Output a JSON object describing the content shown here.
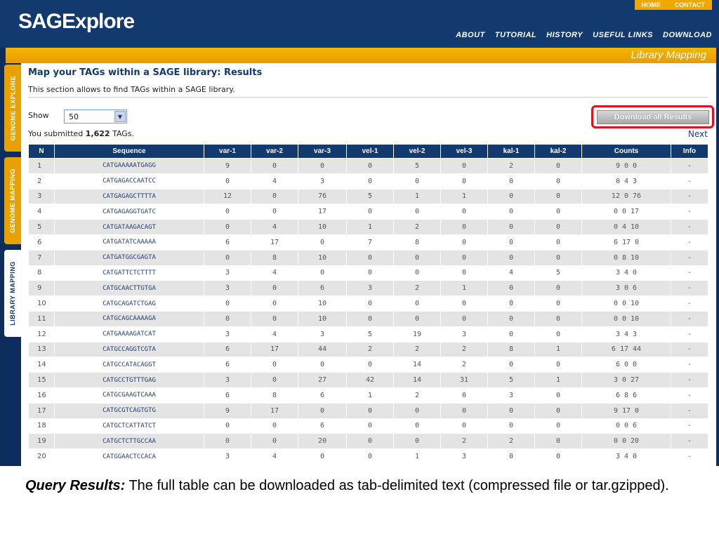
{
  "app": {
    "logo": "SAGExplore",
    "top_links": [
      "HOME",
      "CONTACT"
    ],
    "nav_links": [
      "ABOUT",
      "TUTORIAL",
      "HISTORY",
      "USEFUL LINKS",
      "DOWNLOAD"
    ],
    "section_title": "Library Mapping",
    "side_tabs": [
      "GENOME EXPLORE",
      "GENOME MAPPING",
      "LIBRARY MAPPING"
    ]
  },
  "page": {
    "title": "Map your TAGs within a SAGE library: Results",
    "description": "This section allows to find TAGs within a SAGE library.",
    "show_label": "Show",
    "show_value": "50",
    "submitted_prefix": "You submitted ",
    "submitted_count": "1,622",
    "submitted_suffix": " TAGs.",
    "download_label": "Download all Results",
    "next_label": "Next"
  },
  "table": {
    "headers": [
      "N",
      "Sequence",
      "var-1",
      "var-2",
      "var-3",
      "vel-1",
      "vel-2",
      "vel-3",
      "kal-1",
      "kal-2",
      "Counts",
      "Info"
    ],
    "rows": [
      [
        "1",
        "CATGAAAAATGAGG",
        "9",
        "0",
        "0",
        "0",
        "5",
        "0",
        "2",
        "0",
        "9 0 0",
        "-"
      ],
      [
        "2",
        "CATGAGACCAATCC",
        "0",
        "4",
        "3",
        "0",
        "0",
        "0",
        "0",
        "0",
        "0 4 3",
        "-"
      ],
      [
        "3",
        "CATGAGAGCTTTTA",
        "12",
        "0",
        "76",
        "5",
        "1",
        "1",
        "0",
        "0",
        "12 0 76",
        "-"
      ],
      [
        "4",
        "CATGAGAGGTGATC",
        "0",
        "0",
        "17",
        "0",
        "0",
        "0",
        "0",
        "0",
        "0 0 17",
        "-"
      ],
      [
        "5",
        "CATGATAAGACAGT",
        "0",
        "4",
        "10",
        "1",
        "2",
        "0",
        "0",
        "0",
        "0 4 10",
        "-"
      ],
      [
        "6",
        "CATGATATCAAAAA",
        "6",
        "17",
        "0",
        "7",
        "8",
        "0",
        "0",
        "0",
        "6 17 0",
        "-"
      ],
      [
        "7",
        "CATGATGGCGAGTA",
        "0",
        "8",
        "10",
        "0",
        "0",
        "0",
        "0",
        "0",
        "0 8 10",
        "-"
      ],
      [
        "8",
        "CATGATTCTCTTTT",
        "3",
        "4",
        "0",
        "0",
        "0",
        "0",
        "4",
        "5",
        "3 4 0",
        "-"
      ],
      [
        "9",
        "CATGCAACTTGTGA",
        "3",
        "0",
        "6",
        "3",
        "2",
        "1",
        "0",
        "0",
        "3 0 6",
        "-"
      ],
      [
        "10",
        "CATGCAGATCTGAG",
        "0",
        "0",
        "10",
        "0",
        "0",
        "0",
        "0",
        "0",
        "0 0 10",
        "-"
      ],
      [
        "11",
        "CATGCAGCAAAAGA",
        "0",
        "0",
        "10",
        "0",
        "0",
        "0",
        "0",
        "0",
        "0 0 10",
        "-"
      ],
      [
        "12",
        "CATGAAAAGATCAT",
        "3",
        "4",
        "3",
        "5",
        "19",
        "3",
        "0",
        "0",
        "3 4 3",
        "-"
      ],
      [
        "13",
        "CATGCCAGGTCGTA",
        "6",
        "17",
        "44",
        "2",
        "2",
        "2",
        "8",
        "1",
        "6 17 44",
        "-"
      ],
      [
        "14",
        "CATGCCATACAGGT",
        "6",
        "0",
        "0",
        "0",
        "14",
        "2",
        "0",
        "0",
        "6 0 0",
        "-"
      ],
      [
        "15",
        "CATGCCTGTTTGAG",
        "3",
        "0",
        "27",
        "42",
        "14",
        "31",
        "5",
        "1",
        "3 0 27",
        "-"
      ],
      [
        "16",
        "CATGCGAAGTCAAA",
        "6",
        "8",
        "6",
        "1",
        "2",
        "0",
        "3",
        "0",
        "6 8 6",
        "-"
      ],
      [
        "17",
        "CATGCGTCAGTGTG",
        "9",
        "17",
        "0",
        "0",
        "0",
        "0",
        "0",
        "0",
        "9 17 0",
        "-"
      ],
      [
        "18",
        "CATGCTCATTATCT",
        "0",
        "0",
        "6",
        "0",
        "0",
        "0",
        "0",
        "0",
        "0 0 6",
        "-"
      ],
      [
        "19",
        "CATGCTCTTGCCAA",
        "0",
        "0",
        "20",
        "0",
        "0",
        "2",
        "2",
        "0",
        "0 0 20",
        "-"
      ],
      [
        "20",
        "CATGGAACTCCACA",
        "3",
        "4",
        "0",
        "0",
        "1",
        "3",
        "0",
        "0",
        "3 4 0",
        "-"
      ]
    ]
  },
  "caption": {
    "lead": "Query Results:",
    "text": " The full table can be downloaded as tab-delimited text (compressed file or tar.gzipped)."
  },
  "colors": {
    "navy": "#123a6e",
    "orange": "#f0a800",
    "highlight": "#e01020"
  }
}
